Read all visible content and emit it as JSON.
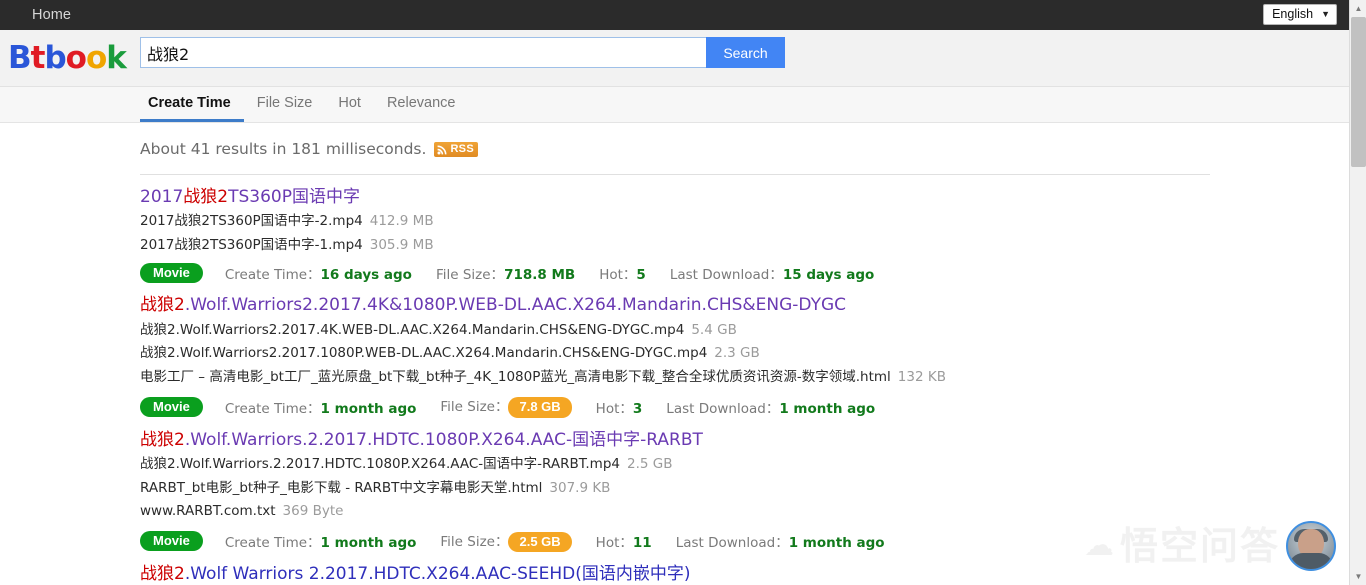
{
  "topnav": {
    "home_label": "Home",
    "language": "English",
    "caret": "▼"
  },
  "brand": {
    "letters": [
      "B",
      "t",
      "b",
      "o",
      "o",
      "k"
    ],
    "colors": [
      "#2a56d8",
      "#e01b24",
      "#2a56d8",
      "#e01b24",
      "#f0a500",
      "#1a9c3c"
    ]
  },
  "search": {
    "value": "战狼2",
    "placeholder": "",
    "button_label": "Search"
  },
  "tabs": [
    {
      "label": "Create Time",
      "active": true
    },
    {
      "label": "File Size",
      "active": false
    },
    {
      "label": "Hot",
      "active": false
    },
    {
      "label": "Relevance",
      "active": false
    }
  ],
  "stats": {
    "text": "About 41 results in 181 milliseconds.",
    "result_count": 41,
    "time_ms": 181,
    "rss_label": "RSS"
  },
  "meta_labels": {
    "create_time": "Create Time：",
    "file_size": "File Size：",
    "hot": "Hot：",
    "last_download": "Last Download："
  },
  "results": [
    {
      "title_highlight": "战狼2",
      "title_prefix": "2017",
      "title_suffix": "TS360P国语中字",
      "visited": true,
      "files": [
        {
          "name": "2017战狼2TS360P国语中字-2.mp4",
          "size": "412.9 MB"
        },
        {
          "name": "2017战狼2TS360P国语中字-1.mp4",
          "size": "305.9 MB"
        }
      ],
      "category": "Movie",
      "create_time": "16 days ago",
      "file_size": "718.8 MB",
      "file_size_pill": false,
      "hot": "5",
      "last_download": "15 days ago"
    },
    {
      "title_highlight": "战狼2",
      "title_prefix": "",
      "title_suffix": ".Wolf.Warriors2.2017.4K&1080P.WEB-DL.AAC.X264.Mandarin.CHS&ENG-DYGC",
      "visited": true,
      "files": [
        {
          "name": "战狼2.Wolf.Warriors2.2017.4K.WEB-DL.AAC.X264.Mandarin.CHS&ENG-DYGC.mp4",
          "size": "5.4 GB"
        },
        {
          "name": "战狼2.Wolf.Warriors2.2017.1080P.WEB-DL.AAC.X264.Mandarin.CHS&ENG-DYGC.mp4",
          "size": "2.3 GB"
        },
        {
          "name": "电影工厂 – 高清电影_bt工厂_蓝光原盘_bt下载_bt种子_4K_1080P蓝光_高清电影下载_整合全球优质资讯资源-数字领域.html",
          "size": "132 KB"
        }
      ],
      "category": "Movie",
      "create_time": "1 month ago",
      "file_size": "7.8 GB",
      "file_size_pill": true,
      "hot": "3",
      "last_download": "1 month ago"
    },
    {
      "title_highlight": "战狼2",
      "title_prefix": "",
      "title_suffix": ".Wolf.Warriors.2.2017.HDTC.1080P.X264.AAC-国语中字-RARBT",
      "visited": true,
      "files": [
        {
          "name": "战狼2.Wolf.Warriors.2.2017.HDTC.1080P.X264.AAC-国语中字-RARBT.mp4",
          "size": "2.5 GB"
        },
        {
          "name": "RARBT_bt电影_bt种子_电影下载 - RARBT中文字幕电影天堂.html",
          "size": "307.9 KB"
        },
        {
          "name": "www.RARBT.com.txt",
          "size": "369 Byte"
        }
      ],
      "category": "Movie",
      "create_time": "1 month ago",
      "file_size": "2.5 GB",
      "file_size_pill": true,
      "hot": "11",
      "last_download": "1 month ago"
    },
    {
      "title_highlight": "战狼2",
      "title_prefix": "",
      "title_suffix": ".Wolf Warriors 2.2017.HDTC.X264.AAC-SEEHD(国语内嵌中字)",
      "visited": false,
      "files": [],
      "category": "",
      "create_time": "",
      "file_size": "",
      "file_size_pill": false,
      "hot": "",
      "last_download": ""
    }
  ],
  "watermark": {
    "text": "悟空问答",
    "cloud": "☁"
  },
  "colors": {
    "accent_blue": "#4285f4",
    "link_purple": "#6a3ab2",
    "link_blue": "#2f2fbb",
    "highlight_red": "#cc0000",
    "meta_green": "#127a1c",
    "badge_green": "#0a9f1e",
    "badge_orange": "#f5a623",
    "navbar_dark": "#2b2b2b"
  }
}
